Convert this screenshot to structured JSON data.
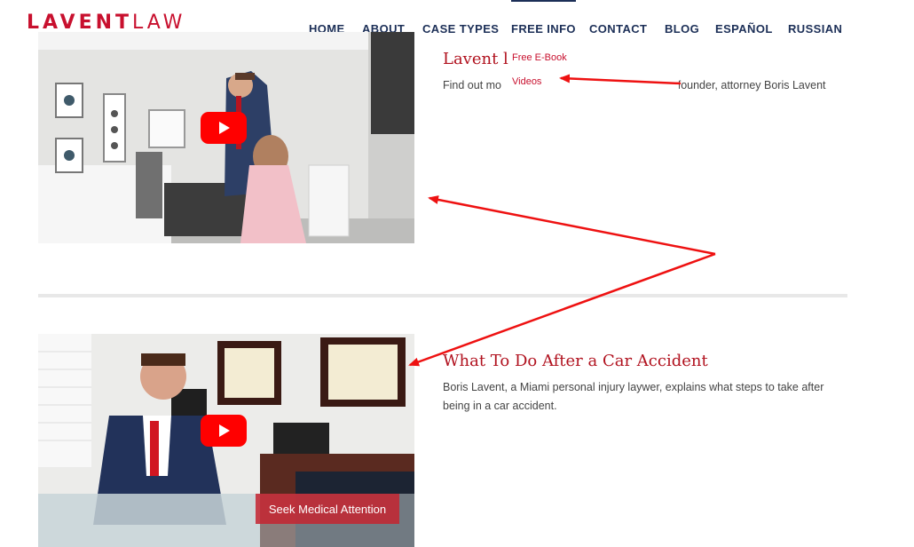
{
  "logo": {
    "bold": "LAVENT",
    "light": "LAW"
  },
  "nav": {
    "items": [
      "HOME",
      "ABOUT",
      "CASE TYPES",
      "FREE INFO",
      "CONTACT",
      "BLOG",
      "ESPAÑOL",
      "RUSSIAN"
    ],
    "active": "FREE INFO"
  },
  "dropdown": {
    "items": [
      "Free E-Book",
      "Videos"
    ]
  },
  "posts": [
    {
      "title": "Lavent l",
      "description_start": "Find out mo",
      "description_end": "s founder, attorney Boris Lavent"
    },
    {
      "title": "What To Do After a Car Accident",
      "description": "Boris Lavent, a Miami personal injury laywer, explains what steps to take after being in a car accident.",
      "video_caption": "Seek Medical Attention"
    }
  ],
  "colors": {
    "brand_red": "#c8102e",
    "nav_navy": "#1c2f57",
    "annotation_red": "#ee1111",
    "youtube_red": "#ff0000"
  },
  "icons": {
    "play": "youtube-play-icon"
  }
}
